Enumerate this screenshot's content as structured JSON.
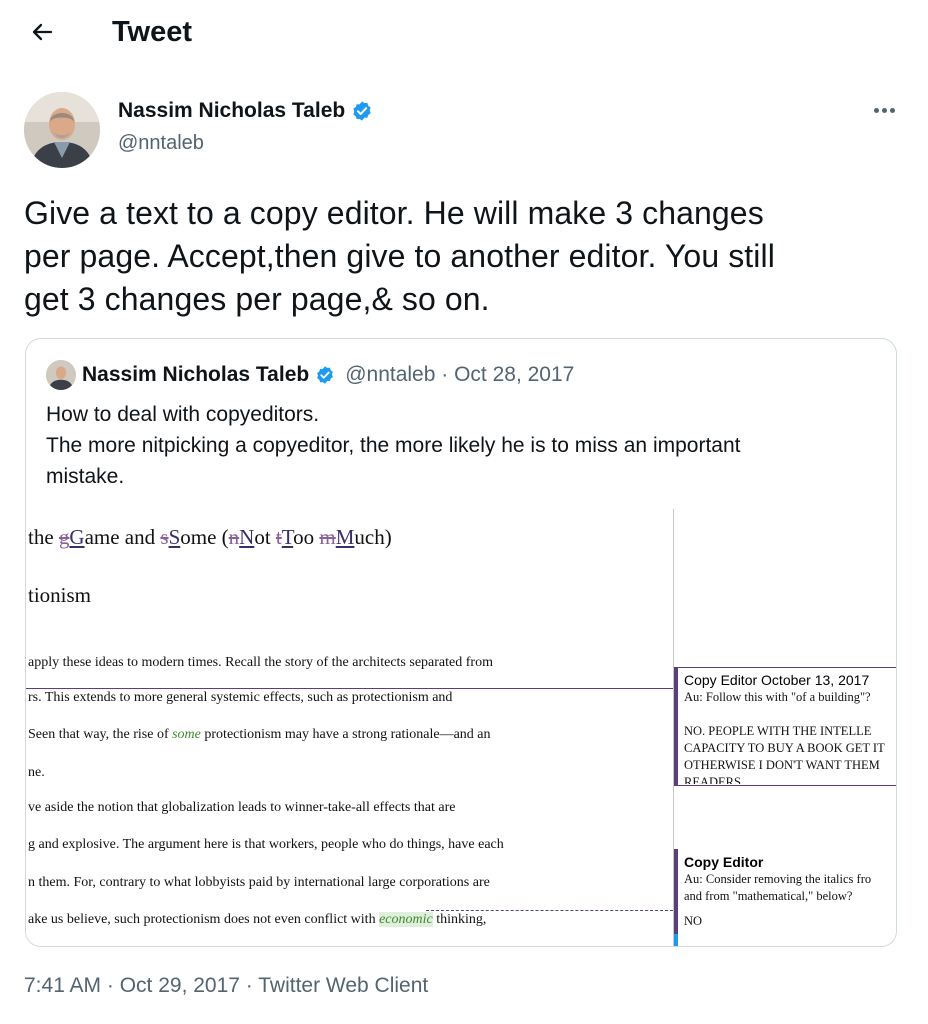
{
  "header": {
    "title": "Tweet"
  },
  "author": {
    "name": "Nassim Nicholas Taleb",
    "handle": "@nntaleb",
    "verified": true
  },
  "tweet": {
    "lines": [
      "Give a text to a copy editor. He will make 3 changes",
      "per page. Accept,then give to another editor. You still",
      "get 3 changes per page,& so on."
    ],
    "footer": "7:41 AM · Oct 29, 2017 · Twitter Web Client"
  },
  "quoted": {
    "name": "Nassim Nicholas Taleb",
    "meta": "@nntaleb · Oct 28, 2017",
    "lines": [
      "How to deal with copyeditors.",
      "The more nitpicking a copyeditor, the more likely he is to miss an important",
      "mistake."
    ]
  },
  "document": {
    "heading": {
      "p1": "the ",
      "d1": "g",
      "i1": "G",
      "p2": "ame and ",
      "d2": "s",
      "i2": "S",
      "p3": "ome (",
      "d3": "n",
      "i3": "N",
      "p4": "ot ",
      "d4": "t",
      "i4": "T",
      "p5": "oo ",
      "d5": "m",
      "i5": "M",
      "p6": "uch)"
    },
    "subheading": "tionism",
    "lines": [
      "apply these ideas to modern times. Recall the story of the architects separated from",
      "rs. This extends to more general systemic effects, such as protectionism and",
      {
        "a": "Seen that way, the rise of ",
        "i": "some",
        "b": " protectionism may have a strong rationale—and an"
      },
      "ne.",
      "ve aside the notion that globalization leads to winner-take-all effects that are",
      "g and explosive. The argument here is that workers, people who do things, have each",
      "n them. For, contrary to what lobbyists paid by international large corporations are",
      {
        "a": "ake us believe, such protectionism does not even conflict with ",
        "i": "economic",
        "b": " thinking,"
      }
    ],
    "comments": [
      {
        "author": "Copy Editor",
        "date": "October 13, 2017",
        "lines": [
          "Au: Follow this with \"of a building\"?",
          "",
          "NO.  PEOPLE WITH THE INTELLE",
          "CAPACITY TO BUY A BOOK GET IT",
          "OTHERWISE I DON'T WANT THEM",
          "READERS."
        ]
      },
      {
        "author": "Copy Editor",
        "date": "",
        "lines": [
          "Au: Consider removing the italics fro",
          "and from \"mathematical,\" below?",
          "",
          "NO"
        ]
      }
    ]
  },
  "colors": {
    "verified": "#1d9bf0",
    "muted": "#536471",
    "border": "#cfd9de",
    "track_change": "#5b3f77",
    "italic_green": "#3f8a2c"
  }
}
